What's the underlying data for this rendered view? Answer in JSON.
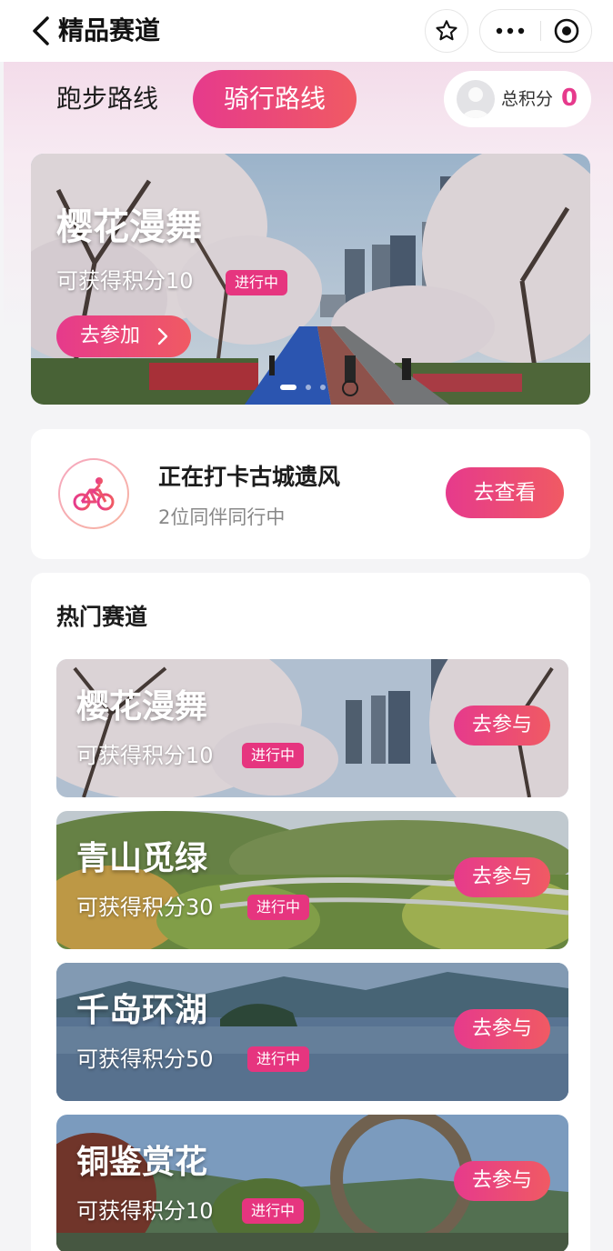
{
  "navbar": {
    "title": "精品赛道",
    "icons": [
      "back-arrow-icon",
      "star-icon",
      "more-dots-icon",
      "record-target-icon"
    ]
  },
  "tabs": {
    "run_label": "跑步路线",
    "ride_label": "骑行路线",
    "active": "ride"
  },
  "points": {
    "label": "总积分",
    "value": "0"
  },
  "banner": {
    "title": "樱花漫舞",
    "points_text": "可获得积分10",
    "status_badge": "进行中",
    "join_button": "去参加",
    "slide_count": 3,
    "active_slide": 1
  },
  "checkin": {
    "title": "正在打卡古城遗风",
    "subtitle": "2位同伴同行中",
    "view_button": "去查看",
    "icon": "cycling-icon"
  },
  "hot_tracks": {
    "section_title": "热门赛道",
    "items": [
      {
        "name": "樱花漫舞",
        "points_text": "可获得积分10",
        "status_badge": "进行中",
        "button": "去参与"
      },
      {
        "name": "青山觅绿",
        "points_text": "可获得积分30",
        "status_badge": "进行中",
        "button": "去参与"
      },
      {
        "name": "千岛环湖",
        "points_text": "可获得积分50",
        "status_badge": "进行中",
        "button": "去参与"
      },
      {
        "name": "铜鉴赏花",
        "points_text": "可获得积分10",
        "status_badge": "进行中",
        "button": "去参与"
      }
    ]
  },
  "colors": {
    "accent_start": "#e63a8c",
    "accent_end": "#f05a63",
    "badge": "#e6357f"
  }
}
